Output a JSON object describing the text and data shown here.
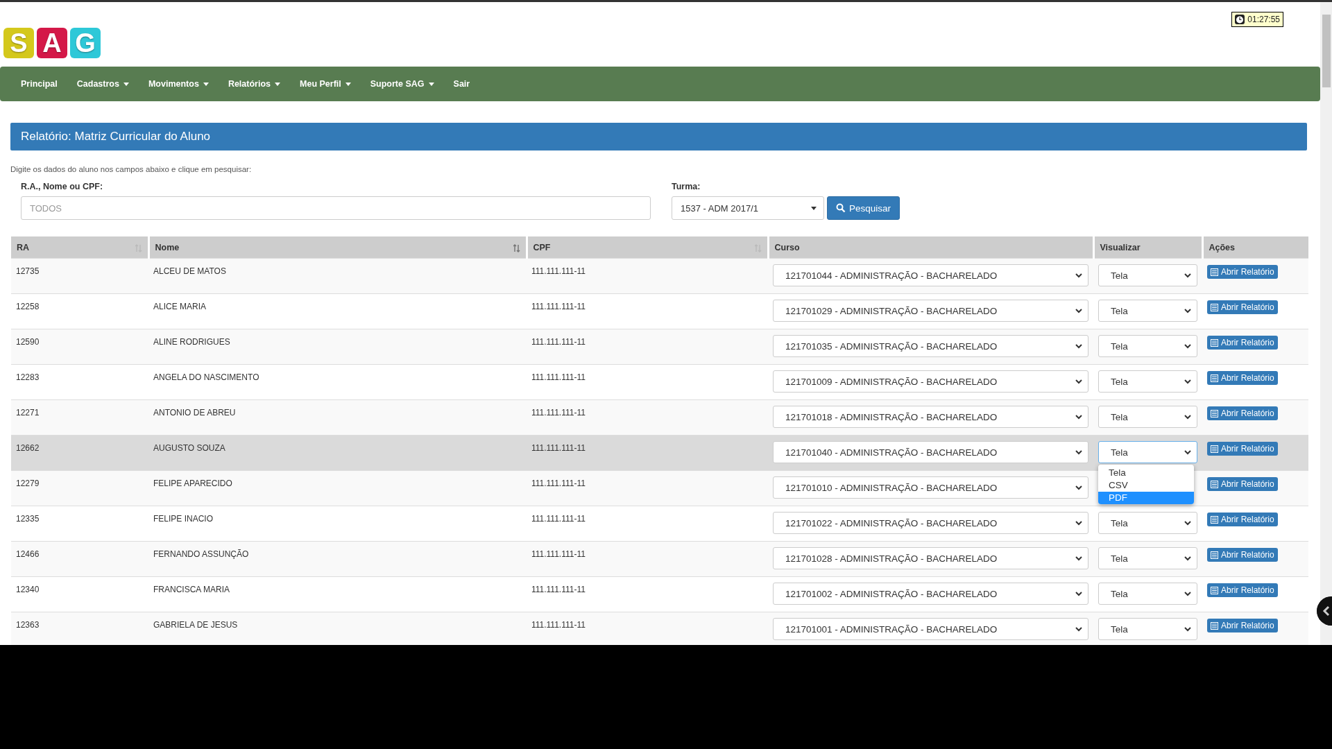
{
  "logo": {
    "letters": [
      {
        "char": "S",
        "color": "#d4c81c"
      },
      {
        "char": "A",
        "color": "#d41848"
      },
      {
        "char": "G",
        "color": "#2ec8d8"
      }
    ]
  },
  "timer": "01:27:55",
  "nav": [
    {
      "label": "Principal",
      "dropdown": false
    },
    {
      "label": "Cadastros",
      "dropdown": true
    },
    {
      "label": "Movimentos",
      "dropdown": true
    },
    {
      "label": "Relatórios",
      "dropdown": true
    },
    {
      "label": "Meu Perfil",
      "dropdown": true
    },
    {
      "label": "Suporte SAG",
      "dropdown": true
    },
    {
      "label": "Sair",
      "dropdown": false
    }
  ],
  "panel": {
    "title": "Relatório: Matriz Curricular do Aluno"
  },
  "hint": "Digite os dados do aluno nos campos abaixo e clique em pesquisar:",
  "search": {
    "label": "R.A., Nome ou CPF:",
    "placeholder": "TODOS"
  },
  "turma": {
    "label": "Turma:",
    "value": "1537 - ADM 2017/1"
  },
  "search_button": "Pesquisar",
  "table": {
    "columns": [
      {
        "label": "RA",
        "sortable": true,
        "sorted": false
      },
      {
        "label": "Nome",
        "sortable": true,
        "sorted": true
      },
      {
        "label": "CPF",
        "sortable": true,
        "sorted": false
      },
      {
        "label": "Curso",
        "sortable": false
      },
      {
        "label": "Visualizar",
        "sortable": false
      },
      {
        "label": "Ações",
        "sortable": false
      }
    ],
    "rows": [
      {
        "ra": "12735",
        "nome": "ALCEU DE MATOS",
        "cpf": "111.111.111-11",
        "curso": "121701044 - ADMINISTRAÇÃO - BACHARELADO",
        "visualizar": "Tela",
        "action": "Abrir Relatório",
        "selected": false
      },
      {
        "ra": "12258",
        "nome": "ALICE MARIA",
        "cpf": "111.111.111-11",
        "curso": "121701029 - ADMINISTRAÇÃO - BACHARELADO",
        "visualizar": "Tela",
        "action": "Abrir Relatório",
        "selected": false
      },
      {
        "ra": "12590",
        "nome": "ALINE RODRIGUES",
        "cpf": "111.111.111-11",
        "curso": "121701035 - ADMINISTRAÇÃO - BACHARELADO",
        "visualizar": "Tela",
        "action": "Abrir Relatório",
        "selected": false
      },
      {
        "ra": "12283",
        "nome": "ANGELA DO NASCIMENTO",
        "cpf": "111.111.111-11",
        "curso": "121701009 - ADMINISTRAÇÃO - BACHARELADO",
        "visualizar": "Tela",
        "action": "Abrir Relatório",
        "selected": false
      },
      {
        "ra": "12271",
        "nome": "ANTONIO DE ABREU",
        "cpf": "111.111.111-11",
        "curso": "121701018 - ADMINISTRAÇÃO - BACHARELADO",
        "visualizar": "Tela",
        "action": "Abrir Relatório",
        "selected": false
      },
      {
        "ra": "12662",
        "nome": "AUGUSTO SOUZA",
        "cpf": "111.111.111-11",
        "curso": "121701040 - ADMINISTRAÇÃO - BACHARELADO",
        "visualizar": "Tela",
        "action": "Abrir Relatório",
        "selected": true,
        "menu": [
          {
            "label": "Tela",
            "selected": false
          },
          {
            "label": "CSV",
            "selected": false
          },
          {
            "label": "PDF",
            "selected": true
          }
        ]
      },
      {
        "ra": "12279",
        "nome": "FELIPE APARECIDO",
        "cpf": "111.111.111-11",
        "curso": "121701010 - ADMINISTRAÇÃO - BACHARELADO",
        "action": "Abrir Relatório",
        "selected": false
      },
      {
        "ra": "12335",
        "nome": "FELIPE INACIO",
        "cpf": "111.111.111-11",
        "curso": "121701022 - ADMINISTRAÇÃO - BACHARELADO",
        "visualizar": "Tela",
        "action": "Abrir Relatório",
        "selected": false
      },
      {
        "ra": "12466",
        "nome": "FERNANDO ASSUNÇÃO",
        "cpf": "111.111.111-11",
        "curso": "121701028 - ADMINISTRAÇÃO - BACHARELADO",
        "visualizar": "Tela",
        "action": "Abrir Relatório",
        "selected": false
      },
      {
        "ra": "12340",
        "nome": "FRANCISCA MARIA",
        "cpf": "111.111.111-11",
        "curso": "121701002 - ADMINISTRAÇÃO - BACHARELADO",
        "visualizar": "Tela",
        "action": "Abrir Relatório",
        "selected": false
      },
      {
        "ra": "12363",
        "nome": "GABRIELA DE JESUS",
        "cpf": "111.111.111-11",
        "curso": "121701001 - ADMINISTRAÇÃO - BACHARELADO",
        "visualizar": "Tela",
        "action": "Abrir Relatório",
        "selected": false
      }
    ]
  }
}
